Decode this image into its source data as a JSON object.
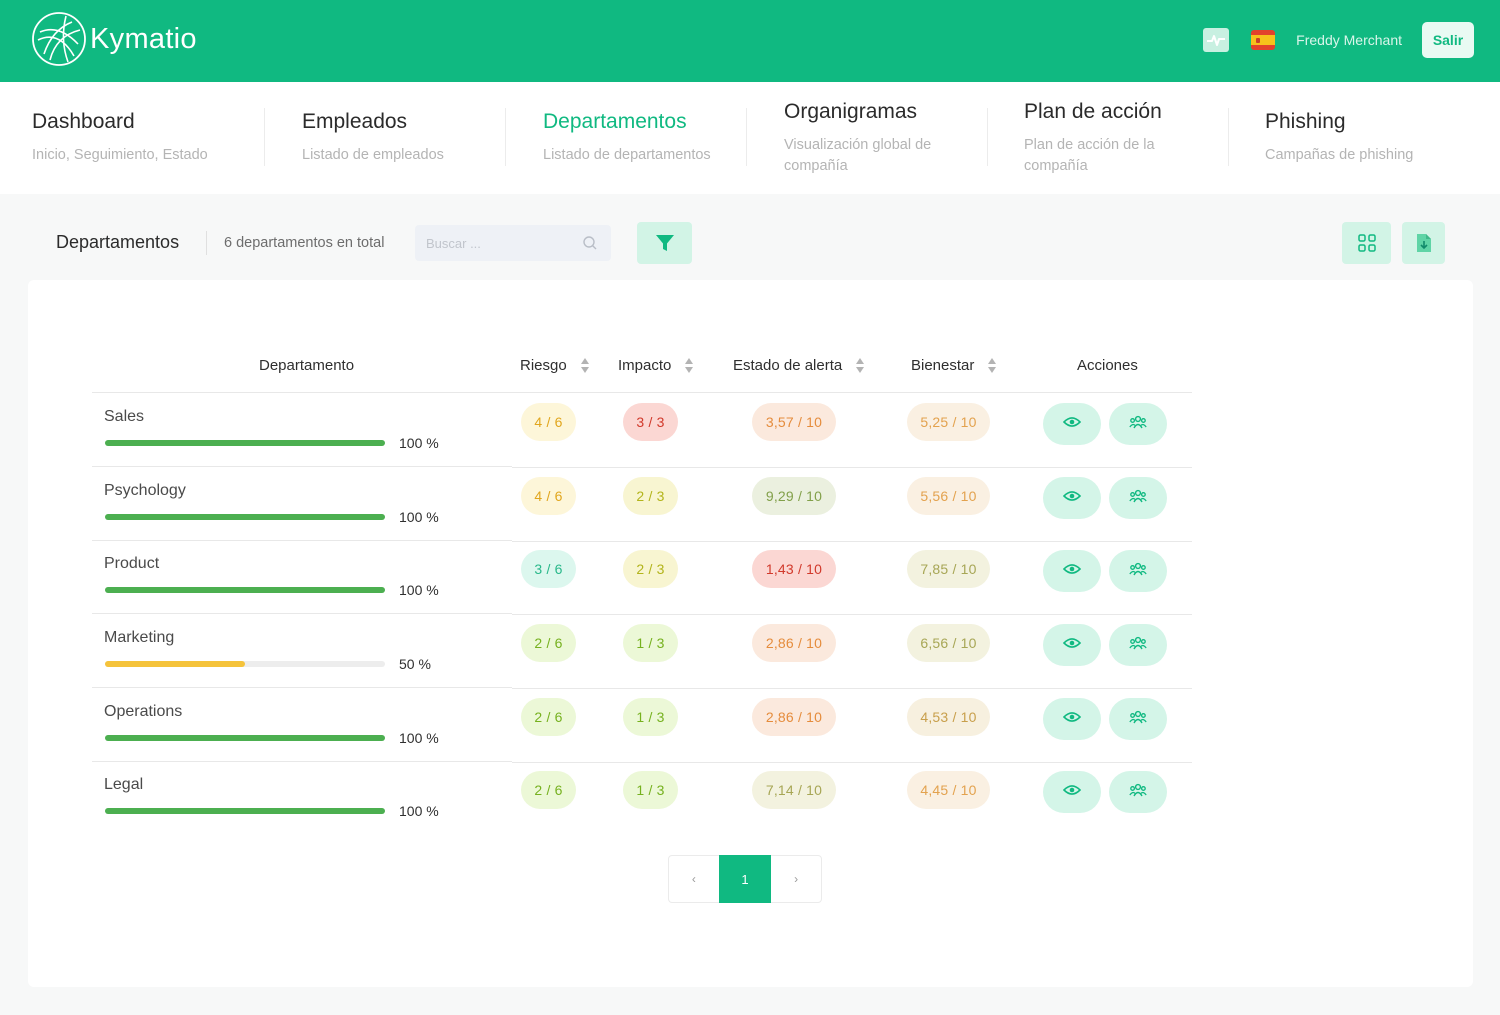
{
  "header": {
    "brand": "Kymatio",
    "user_name": "Freddy Merchant",
    "logout_label": "Salir"
  },
  "nav": [
    {
      "title": "Dashboard",
      "subtitle": "Inicio, Seguimiento, Estado"
    },
    {
      "title": "Empleados",
      "subtitle": "Listado de empleados"
    },
    {
      "title": "Departamentos",
      "subtitle": "Listado de departamentos"
    },
    {
      "title": "Organigramas",
      "subtitle_line1": "Visualización global de",
      "subtitle_line2": "compañía"
    },
    {
      "title": "Plan de acción",
      "subtitle_line1": "Plan de acción de la",
      "subtitle_line2": "compañía"
    },
    {
      "title": "Phishing",
      "subtitle": "Campañas de phishing"
    }
  ],
  "toolbar": {
    "title": "Departamentos",
    "total": "6 departamentos en total",
    "search_placeholder": "Buscar ..."
  },
  "table": {
    "columns": [
      "Departamento",
      "Riesgo",
      "Impacto",
      "Estado de alerta",
      "Bienestar",
      "Acciones"
    ],
    "rows": [
      {
        "name": "Sales",
        "progress": 1.0,
        "progress_label": "100 %",
        "riesgo": "4 / 6",
        "impacto": "3 / 3",
        "alerta": "3,57 / 10",
        "bienestar": "5,25 / 10"
      },
      {
        "name": "Psychology",
        "progress": 1.0,
        "progress_label": "100 %",
        "riesgo": "4 / 6",
        "impacto": "2 / 3",
        "alerta": "9,29 / 10",
        "bienestar": "5,56 / 10"
      },
      {
        "name": "Product",
        "progress": 1.0,
        "progress_label": "100 %",
        "riesgo": "3 / 6",
        "impacto": "2 / 3",
        "alerta": "1,43 / 10",
        "bienestar": "7,85 / 10"
      },
      {
        "name": "Marketing",
        "progress": 0.5,
        "progress_label": "50 %",
        "riesgo": "2 / 6",
        "impacto": "1 / 3",
        "alerta": "2,86 / 10",
        "bienestar": "6,56 / 10"
      },
      {
        "name": "Operations",
        "progress": 1.0,
        "progress_label": "100 %",
        "riesgo": "2 / 6",
        "impacto": "1 / 3",
        "alerta": "2,86 / 10",
        "bienestar": "4,53 / 10"
      },
      {
        "name": "Legal",
        "progress": 1.0,
        "progress_label": "100 %",
        "riesgo": "2 / 6",
        "impacto": "1 / 3",
        "alerta": "7,14 / 10",
        "bienestar": "4,45 / 10"
      }
    ]
  },
  "pagination": {
    "prev": "‹",
    "current": "1",
    "next": "›"
  },
  "colors": {
    "brand": "#10b981",
    "progress_full": "#4caf50",
    "progress_half": "#f5c33b"
  },
  "icons": [
    "kymatio-logo-icon",
    "pulse-icon",
    "spain-flag-icon",
    "search-icon",
    "filter-icon",
    "grid-icon",
    "download-icon",
    "eye-icon",
    "group-icon"
  ]
}
